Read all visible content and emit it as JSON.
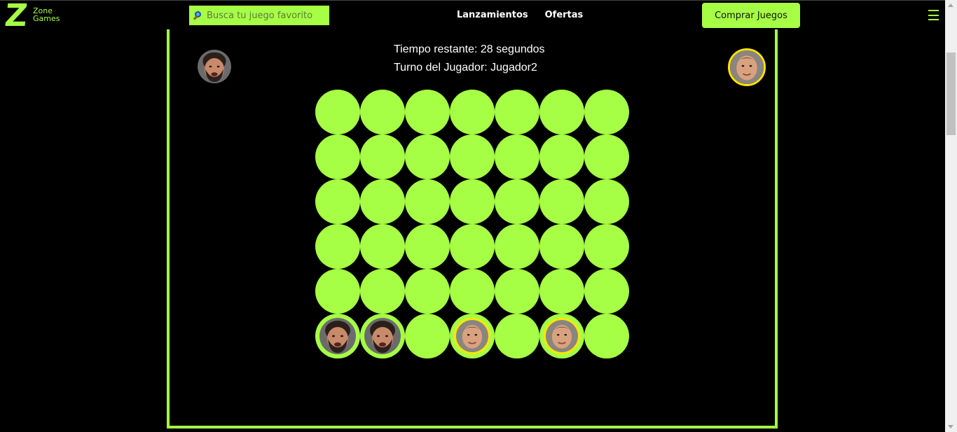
{
  "header": {
    "logo_mark": "Z",
    "logo_line1": "Zone",
    "logo_line2": "Games",
    "search_placeholder": "Busca tu juego favorito",
    "search_icon": "magnifier-icon",
    "nav": [
      "Lanzamientos",
      "Ofertas"
    ],
    "buy_label": "Comprar Juegos",
    "menu_icon": "hamburger-icon"
  },
  "game": {
    "time_label": "Tiempo restante: 28 segundos",
    "turn_label": "Turno del Jugador: Jugador2",
    "player1_avatar": "player1-face-icon",
    "player2_avatar": "player2-face-icon",
    "board": {
      "rows": 6,
      "cols": 7,
      "cells": [
        [
          0,
          0,
          0,
          0,
          0,
          0,
          0
        ],
        [
          0,
          0,
          0,
          0,
          0,
          0,
          0
        ],
        [
          0,
          0,
          0,
          0,
          0,
          0,
          0
        ],
        [
          0,
          0,
          0,
          0,
          0,
          0,
          0
        ],
        [
          0,
          0,
          0,
          0,
          0,
          0,
          0
        ],
        [
          1,
          1,
          0,
          2,
          0,
          2,
          0
        ]
      ]
    }
  },
  "colors": {
    "accent": "#a6ff45",
    "player2_ring": "#ffe500",
    "background": "#000000"
  }
}
